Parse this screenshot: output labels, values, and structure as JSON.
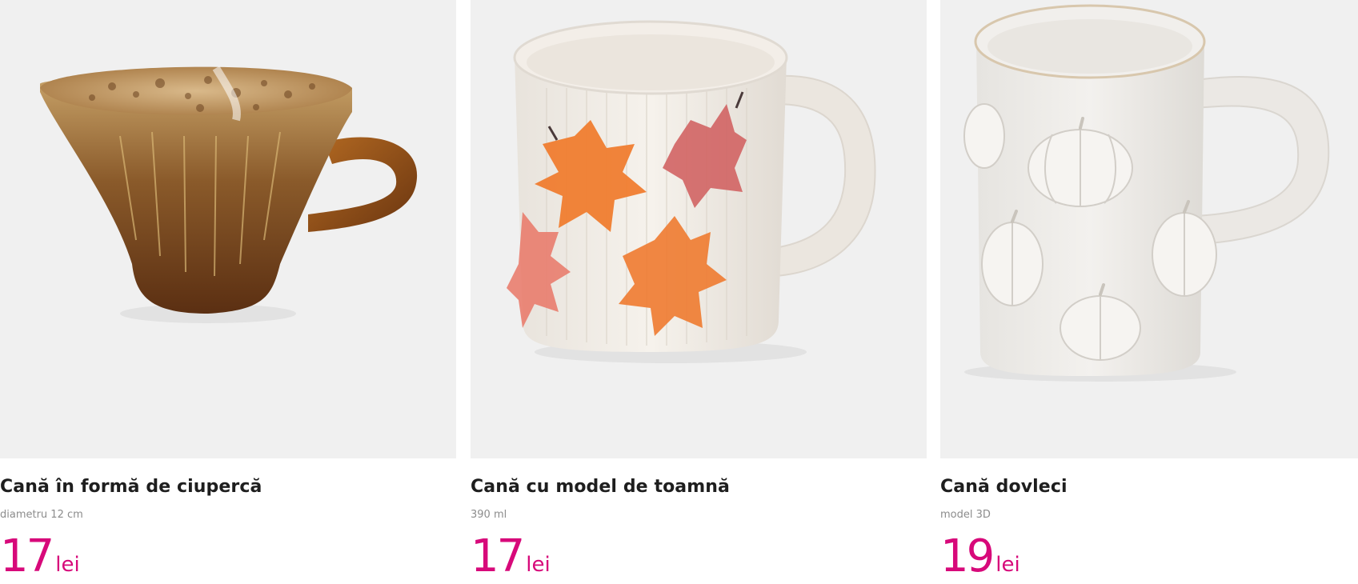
{
  "products": [
    {
      "title": "Cană în formă de ciupercă",
      "subtitle": "diametru 12 cm",
      "price": "17",
      "currency": "lei"
    },
    {
      "title": "Cană cu model de toamnă",
      "subtitle": "390 ml",
      "price": "17",
      "currency": "lei"
    },
    {
      "title": "Cană dovleci",
      "subtitle": "model 3D",
      "price": "19",
      "currency": "lei"
    }
  ],
  "colors": {
    "price": "#d7097a",
    "title": "#1e1e1e",
    "subtitle": "#8c8c8c",
    "image_bg": "#f0f0f0"
  }
}
